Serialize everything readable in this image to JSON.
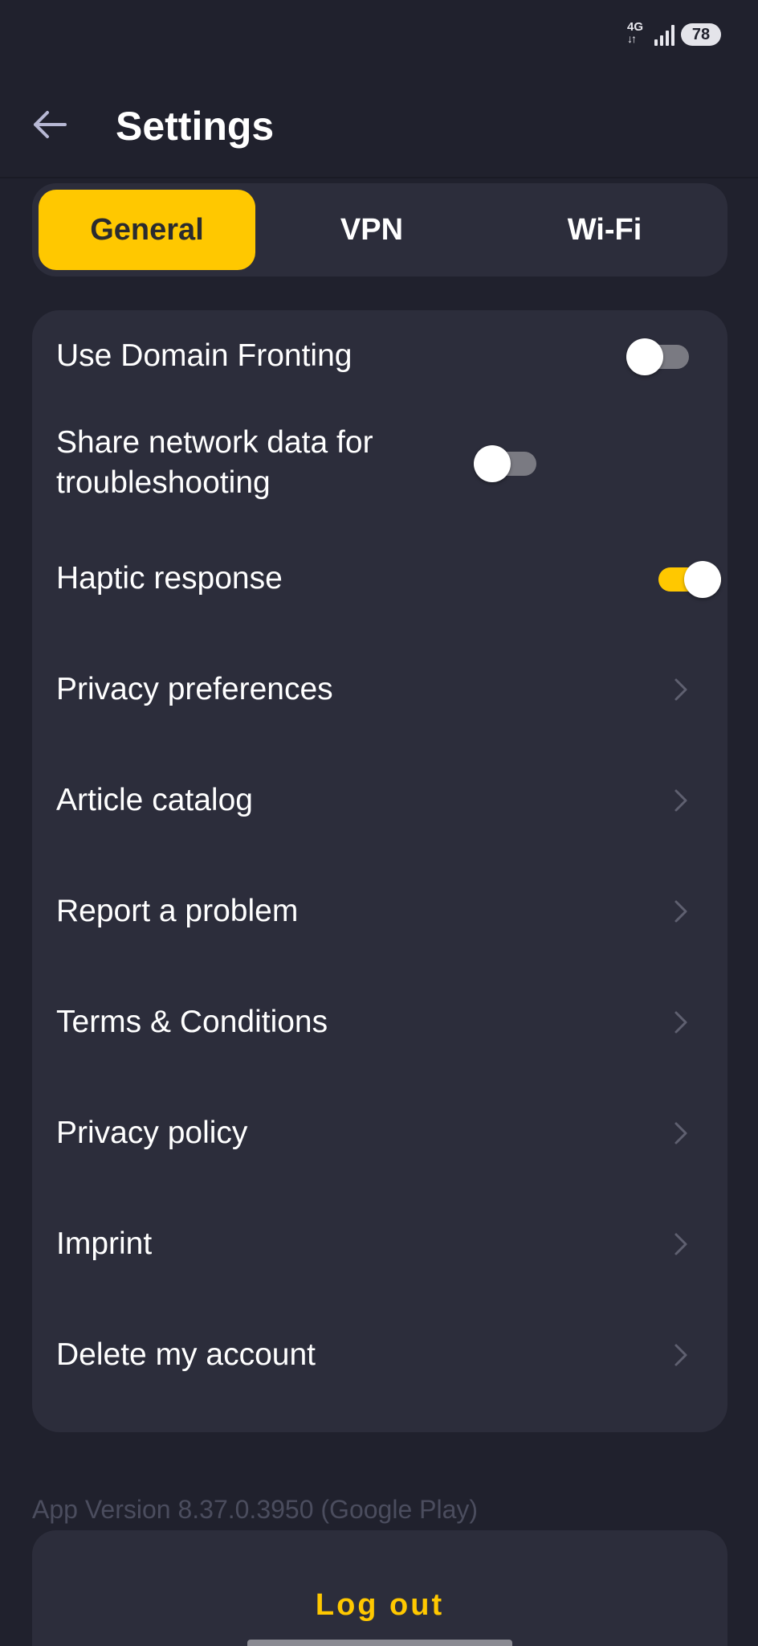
{
  "status_bar": {
    "network": "4G",
    "battery": "78"
  },
  "header": {
    "title": "Settings"
  },
  "tabs": [
    {
      "label": "General",
      "active": true
    },
    {
      "label": "VPN",
      "active": false
    },
    {
      "label": "Wi-Fi",
      "active": false
    }
  ],
  "settings": {
    "toggles": [
      {
        "label": "Use Domain Fronting",
        "on": false
      },
      {
        "label": "Share network data for troubleshooting",
        "on": false
      },
      {
        "label": "Haptic response",
        "on": true
      }
    ],
    "links": [
      {
        "label": "Privacy preferences"
      },
      {
        "label": "Article catalog"
      },
      {
        "label": "Report a problem"
      },
      {
        "label": "Terms & Conditions"
      },
      {
        "label": "Privacy policy"
      },
      {
        "label": "Imprint"
      },
      {
        "label": "Delete my account"
      }
    ]
  },
  "footer": {
    "app_version": "App Version 8.37.0.3950 (Google Play)",
    "logout_label": "Log out"
  },
  "colors": {
    "background": "#20212d",
    "card": "#2c2d3b",
    "accent": "#ffc800"
  },
  "icons": {
    "back": "arrow-left-icon",
    "chevron": "chevron-right-icon",
    "signal": "cell-signal-icon"
  }
}
